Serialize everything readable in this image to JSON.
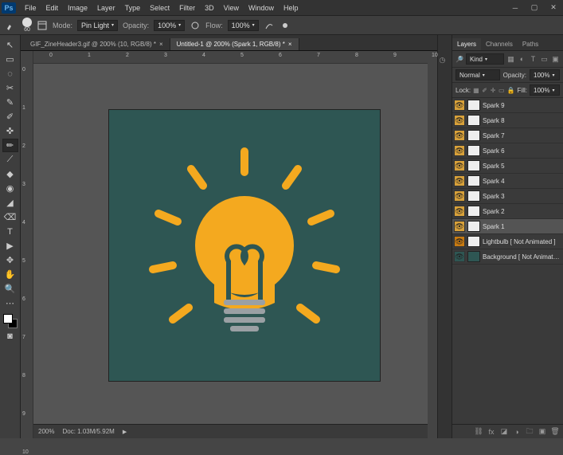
{
  "menus": [
    "File",
    "Edit",
    "Image",
    "Layer",
    "Type",
    "Select",
    "Filter",
    "3D",
    "View",
    "Window",
    "Help"
  ],
  "optbar": {
    "brush_size": "60",
    "mode_label": "Mode:",
    "mode_value": "Pin Light",
    "opacity_label": "Opacity:",
    "opacity_value": "100%",
    "flow_label": "Flow:",
    "flow_value": "100%"
  },
  "tabs": [
    {
      "label": "GIF_ZineHeader3.gif @ 200% (10, RGB/8) *",
      "active": false
    },
    {
      "label": "Untitled-1 @ 200% (Spark 1, RGB/8) *",
      "active": true
    }
  ],
  "hruler": [
    "0",
    "1",
    "2",
    "3",
    "4",
    "5",
    "6",
    "7",
    "8",
    "9",
    "10"
  ],
  "vruler": [
    "0",
    "1",
    "2",
    "3",
    "4",
    "5",
    "6",
    "7",
    "8",
    "9",
    "10"
  ],
  "status": {
    "zoom": "200%",
    "doc": "Doc: 1.03M/5.92M"
  },
  "panel": {
    "tabs": [
      "Layers",
      "Channels",
      "Paths"
    ],
    "kind": "Kind",
    "blend": "Normal",
    "opacity_label": "Opacity:",
    "opacity_value": "100%",
    "lock_label": "Lock:",
    "fill_label": "Fill:",
    "fill_value": "100%"
  },
  "layers": [
    {
      "name": "Spark 9",
      "sel": false,
      "thumb": "sp"
    },
    {
      "name": "Spark 8",
      "sel": false,
      "thumb": "sp"
    },
    {
      "name": "Spark 7",
      "sel": false,
      "thumb": "sp"
    },
    {
      "name": "Spark 6",
      "sel": false,
      "thumb": "sp"
    },
    {
      "name": "Spark 5",
      "sel": false,
      "thumb": "sp"
    },
    {
      "name": "Spark 4",
      "sel": false,
      "thumb": "sp"
    },
    {
      "name": "Spark 3",
      "sel": false,
      "thumb": "sp"
    },
    {
      "name": "Spark 2",
      "sel": false,
      "thumb": "sp"
    },
    {
      "name": "Spark 1",
      "sel": true,
      "thumb": "sp"
    },
    {
      "name": "Lightbulb [ Not Animated ]",
      "sel": false,
      "thumb": "bulb"
    },
    {
      "name": "Background [ Not Animated ]",
      "sel": false,
      "thumb": "bg"
    }
  ],
  "tool_icons": [
    "↖",
    "▭",
    "◌",
    "✂",
    "✎",
    "✐",
    "✜",
    "✏",
    "⟋",
    "◆",
    "◉",
    "◢",
    "⌫",
    "T",
    "▶",
    "✥",
    "✋",
    "🔍",
    "⋯"
  ]
}
